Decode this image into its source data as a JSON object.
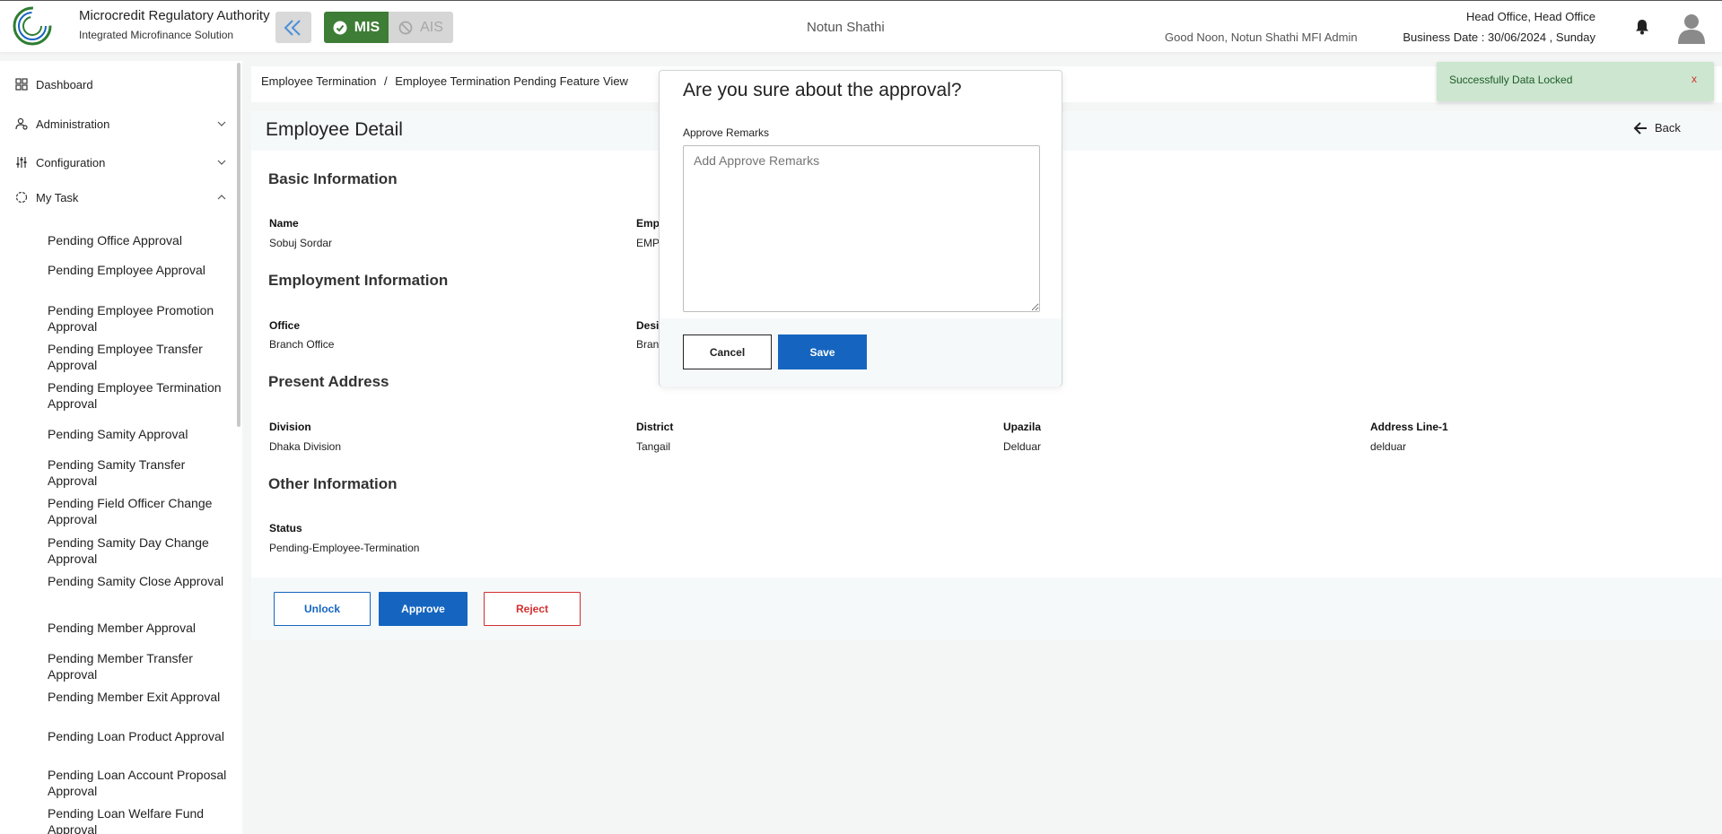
{
  "header": {
    "org_name": "Microcredit Regulatory Authority",
    "org_sub": "Integrated Microfinance Solution",
    "logo_text": "Microcredit Regulatory Authority",
    "mis_label": "MIS",
    "ais_label": "AIS",
    "center_title": "Notun Shathi",
    "greeting": "Good Noon, Notun Shathi MFI Admin",
    "office": "Head Office, Head Office",
    "business_date": "Business Date : 30/06/2024 , Sunday"
  },
  "sidebar": {
    "items": [
      {
        "label": "Dashboard",
        "icon": "dashboard-icon"
      },
      {
        "label": "Administration",
        "icon": "administration-icon"
      },
      {
        "label": "Configuration",
        "icon": "configuration-icon"
      },
      {
        "label": "My Task",
        "icon": "my-task-icon"
      }
    ],
    "subitems": [
      "Pending Office Approval",
      "Pending Employee Approval",
      "Pending Employee Promotion Approval",
      "Pending Employee Transfer Approval",
      "Pending Employee Termination Approval",
      "Pending Samity Approval",
      "Pending Samity Transfer Approval",
      "Pending Field Officer Change Approval",
      "Pending Samity Day Change Approval",
      "Pending Samity Close Approval",
      "Pending Member Approval",
      "Pending Member Transfer Approval",
      "Pending Member Exit Approval",
      "Pending Loan Product Approval",
      "Pending Loan Account Proposal Approval",
      "Pending Loan Welfare Fund Approval"
    ]
  },
  "breadcrumb": {
    "parent": "Employee Termination",
    "separator": "/",
    "current": "Employee Termination Pending Feature View"
  },
  "card": {
    "title": "Employee Detail",
    "back_label": "Back"
  },
  "sections": {
    "basic": {
      "title": "Basic Information",
      "name_label": "Name",
      "name_value": "Sobuj Sordar",
      "emp_label": "Emp",
      "emp_value": "EMP"
    },
    "employment": {
      "title": "Employment Information",
      "office_label": "Office",
      "office_value": "Branch Office",
      "desi_label": "Desi",
      "desi_value": "Bran"
    },
    "present": {
      "title": "Present Address",
      "division_label": "Division",
      "division_value": "Dhaka Division",
      "district_label": "District",
      "district_value": "Tangail",
      "upazila_label": "Upazila",
      "upazila_value": "Delduar",
      "address_label": "Address Line-1",
      "address_value": "delduar"
    },
    "other": {
      "title": "Other Information",
      "status_label": "Status",
      "status_value": "Pending-Employee-Termination"
    }
  },
  "actions": {
    "unlock": "Unlock",
    "approve": "Approve",
    "reject": "Reject"
  },
  "modal": {
    "title": "Are you sure about the approval?",
    "remarks_label": "Approve Remarks",
    "remarks_placeholder": "Add Approve Remarks",
    "remarks_value": "",
    "cancel": "Cancel",
    "save": "Save"
  },
  "toast": {
    "message": "Successfully Data Locked",
    "close": "x"
  },
  "colors": {
    "primary": "#1565c0",
    "mis_green": "#3e7d35",
    "reject_red": "#d32f2f",
    "toast_bg": "#cce6cf"
  }
}
